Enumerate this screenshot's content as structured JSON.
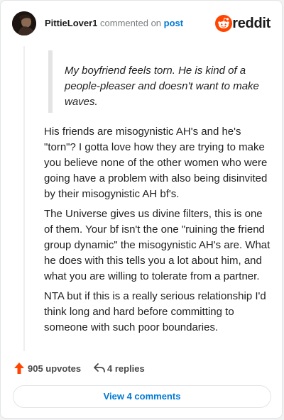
{
  "header": {
    "username": "PittieLover1",
    "action": "commented on",
    "post_link": "post",
    "brand_word": "reddit"
  },
  "comment": {
    "quote": "My boyfriend feels torn. He is kind of a people-pleaser and doesn't want to make waves.",
    "paragraphs": [
      "His friends are misogynistic AH's and he's \"torn\"? I gotta love how they are trying to make you believe none of the other women who were going have a problem with also being disinvited by their misogynistic AH bf's.",
      "The Universe gives us divine filters, this is one of them. Your bf isn't the one \"ruining the friend group dynamic\" the misogynistic AH's are. What he does with this tells you a lot about him, and what you are willing to tolerate from a partner.",
      "NTA but if this is a really serious relationship I'd think long and hard before committing to someone with such poor boundaries."
    ]
  },
  "footer": {
    "upvotes": "905 upvotes",
    "replies": "4 replies",
    "view_comments": "View 4 comments"
  },
  "colors": {
    "accent": "#0079d3",
    "reddit_orange": "#ff4500"
  },
  "icons": {
    "avatar": "avatar",
    "brand": "reddit-logo-icon",
    "upvote": "upvote-arrow-icon",
    "reply": "reply-arrow-icon"
  }
}
